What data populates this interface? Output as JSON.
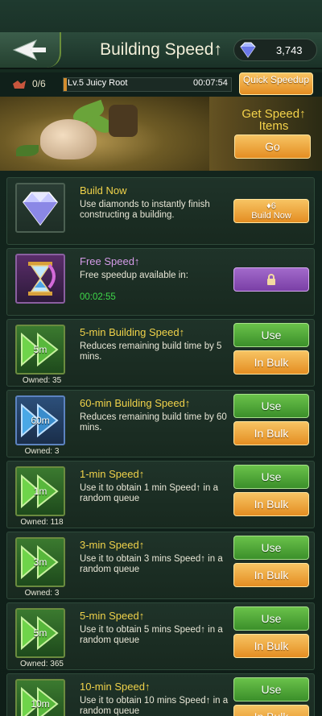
{
  "header": {
    "title": "Building Speed↑",
    "back_icon": "back-arrow-icon",
    "diamonds": "3,743"
  },
  "queue": {
    "count": "0/6",
    "building": "Lv.5 Juicy Root",
    "time_left": "00:07:54",
    "progress": 0.02,
    "quick_speedup_label": "Quick Speedup"
  },
  "banner": {
    "title": "Get Speed↑ Items",
    "go_label": "Go"
  },
  "build_now": {
    "title": "Build Now",
    "desc": "Use diamonds to instantly finish constructing a building.",
    "cost": "6",
    "button_label": "Build Now"
  },
  "free_speed": {
    "title": "Free Speed↑",
    "desc": "Free speedup available in:",
    "timer": "00:02:55",
    "button_icon": "lock-icon"
  },
  "items": [
    {
      "icon_label": "5m",
      "title": "5-min Building Speed↑",
      "desc": "Reduces remaining build time by 5 mins.",
      "owned": "Owned: 35",
      "use": "Use",
      "bulk": "In Bulk"
    },
    {
      "icon_label": "60m",
      "title": "60-min Building Speed↑",
      "desc": "Reduces remaining build time by 60 mins.",
      "owned": "Owned: 3",
      "use": "Use",
      "bulk": "In Bulk"
    },
    {
      "icon_label": "1m",
      "title": "1-min Speed↑",
      "desc": "Use it to obtain 1 min Speed↑ in a random queue",
      "owned": "Owned: 118",
      "use": "Use",
      "bulk": "In Bulk"
    },
    {
      "icon_label": "3m",
      "title": "3-min Speed↑",
      "desc": "Use it to obtain 3 mins Speed↑ in a random queue",
      "owned": "Owned: 3",
      "use": "Use",
      "bulk": "In Bulk"
    },
    {
      "icon_label": "5m",
      "title": "5-min Speed↑",
      "desc": "Use it to obtain 5 mins Speed↑ in a random queue",
      "owned": "Owned: 365",
      "use": "Use",
      "bulk": "In Bulk"
    },
    {
      "icon_label": "10m",
      "title": "10-min Speed↑",
      "desc": "Use it to obtain 10 mins Speed↑ in a random queue",
      "owned": "",
      "use": "Use",
      "bulk": "In Bulk"
    }
  ]
}
